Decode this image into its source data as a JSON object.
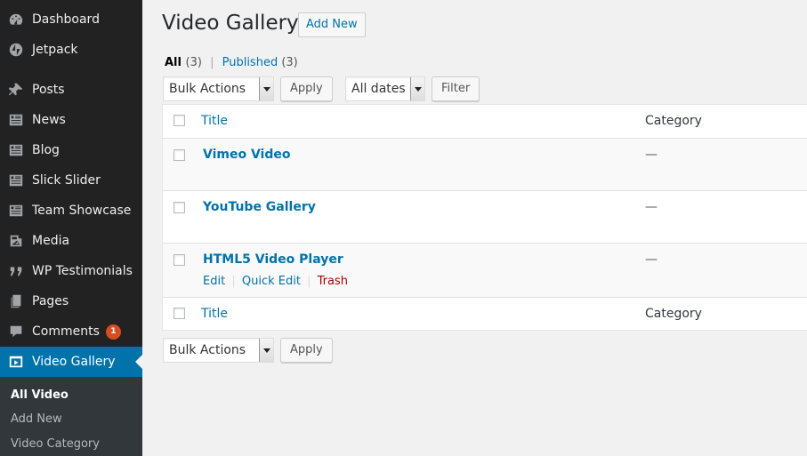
{
  "sidebar": {
    "items": [
      {
        "label": "Dashboard",
        "icon": "dashboard-icon"
      },
      {
        "label": "Jetpack",
        "icon": "jetpack-icon"
      },
      {
        "label": "Posts",
        "icon": "pin-icon"
      },
      {
        "label": "News",
        "icon": "list-icon"
      },
      {
        "label": "Blog",
        "icon": "list-icon"
      },
      {
        "label": "Slick Slider",
        "icon": "list-icon"
      },
      {
        "label": "Team Showcase",
        "icon": "list-icon"
      },
      {
        "label": "Media",
        "icon": "media-icon"
      },
      {
        "label": "WP Testimonials",
        "icon": "quote-icon"
      },
      {
        "label": "Pages",
        "icon": "pages-icon"
      },
      {
        "label": "Comments",
        "icon": "comment-icon",
        "badge": "1"
      },
      {
        "label": "Video Gallery",
        "icon": "video-icon",
        "current": true
      }
    ],
    "submenu": [
      {
        "label": "All Video",
        "current": true
      },
      {
        "label": "Add New"
      },
      {
        "label": "Video Category"
      }
    ]
  },
  "header": {
    "title": "Video Gallery",
    "add_new": "Add New"
  },
  "filters": {
    "all_label": "All",
    "all_count": "(3)",
    "separator": "|",
    "published_label": "Published",
    "published_count": "(3)",
    "bulk_actions": "Bulk Actions",
    "apply": "Apply",
    "dates": "All dates",
    "filter": "Filter"
  },
  "table": {
    "col_title": "Title",
    "col_category": "Category",
    "rows": [
      {
        "title": "Vimeo Video",
        "category": "—"
      },
      {
        "title": "YouTube Gallery",
        "category": "—"
      },
      {
        "title": "HTML5 Video Player",
        "category": "—"
      }
    ],
    "row_actions": {
      "edit": "Edit",
      "quick_edit": "Quick Edit",
      "trash": "Trash",
      "sep": "|"
    }
  },
  "bottom": {
    "bulk_actions": "Bulk Actions",
    "apply": "Apply"
  },
  "colors": {
    "sidebar_bg": "#222222",
    "accent": "#0073aa",
    "badge": "#d54e21",
    "trash": "#aa0000"
  }
}
